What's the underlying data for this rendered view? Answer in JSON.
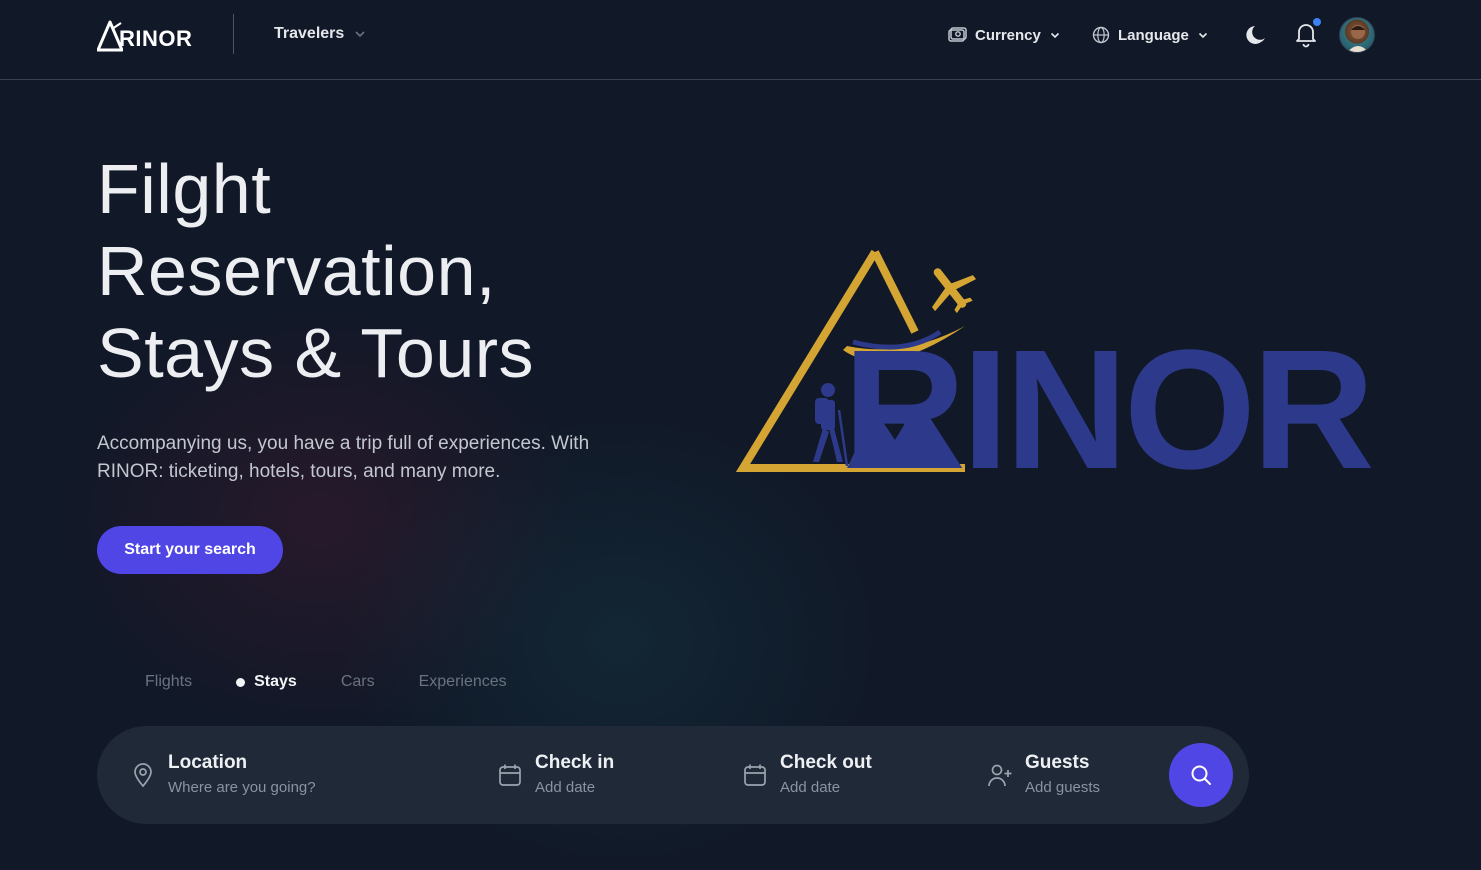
{
  "header": {
    "logo_text": "RINOR",
    "travelers_label": "Travelers",
    "currency_label": "Currency",
    "language_label": "Language",
    "notification_unread": true
  },
  "hero": {
    "title_lines": [
      "Filght",
      "Reservation,",
      "Stays & Tours"
    ],
    "subtitle": "Accompanying us, you have a trip full of experiences. With RINOR: ticketing, hotels, tours, and many more.",
    "cta_label": "Start your search"
  },
  "brand_art": {
    "wordmark": "RINOR",
    "triangle_color": "#d4a532",
    "word_color": "#2d3a8c"
  },
  "tabs": [
    {
      "label": "Flights",
      "active": false
    },
    {
      "label": "Stays",
      "active": true
    },
    {
      "label": "Cars",
      "active": false
    },
    {
      "label": "Experiences",
      "active": false
    }
  ],
  "search": {
    "location": {
      "label": "Location",
      "placeholder": "Where are you going?",
      "icon": "map-pin-icon"
    },
    "checkin": {
      "label": "Check in",
      "placeholder": "Add date",
      "icon": "calendar-icon"
    },
    "checkout": {
      "label": "Check out",
      "placeholder": "Add date",
      "icon": "calendar-icon"
    },
    "guests": {
      "label": "Guests",
      "placeholder": "Add guests",
      "icon": "user-plus-icon"
    }
  },
  "colors": {
    "background": "#111827",
    "accent": "#4f46e5",
    "notification_dot": "#3b82f6"
  }
}
